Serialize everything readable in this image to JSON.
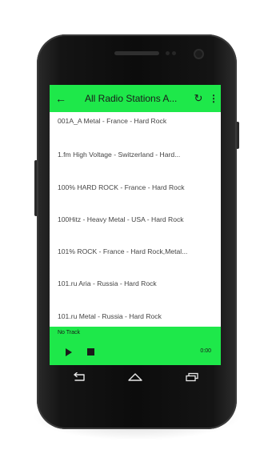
{
  "appbar": {
    "title": "All Radio Stations A...",
    "back_icon": "arrow-left-icon",
    "refresh_icon": "refresh-icon",
    "more_icon": "more-vert-icon"
  },
  "stations": [
    "001A_A Metal - France - Hard Rock",
    "1.fm High Voltage - Switzerland - Hard...",
    "100% HARD ROCK - France - Hard Rock",
    "100Hitz - Heavy Metal - USA - Hard Rock",
    "101% ROCK - France - Hard Rock,Metal...",
    "101.ru Aria - Russia - Hard Rock",
    "101.ru Metal - Russia - Hard Rock"
  ],
  "player": {
    "track": "No Track",
    "time": "0:00",
    "play_icon": "play-icon",
    "stop_icon": "stop-icon"
  },
  "colors": {
    "accent": "#1ee84a",
    "text": "#1a1a1a",
    "list_text": "#444444"
  }
}
